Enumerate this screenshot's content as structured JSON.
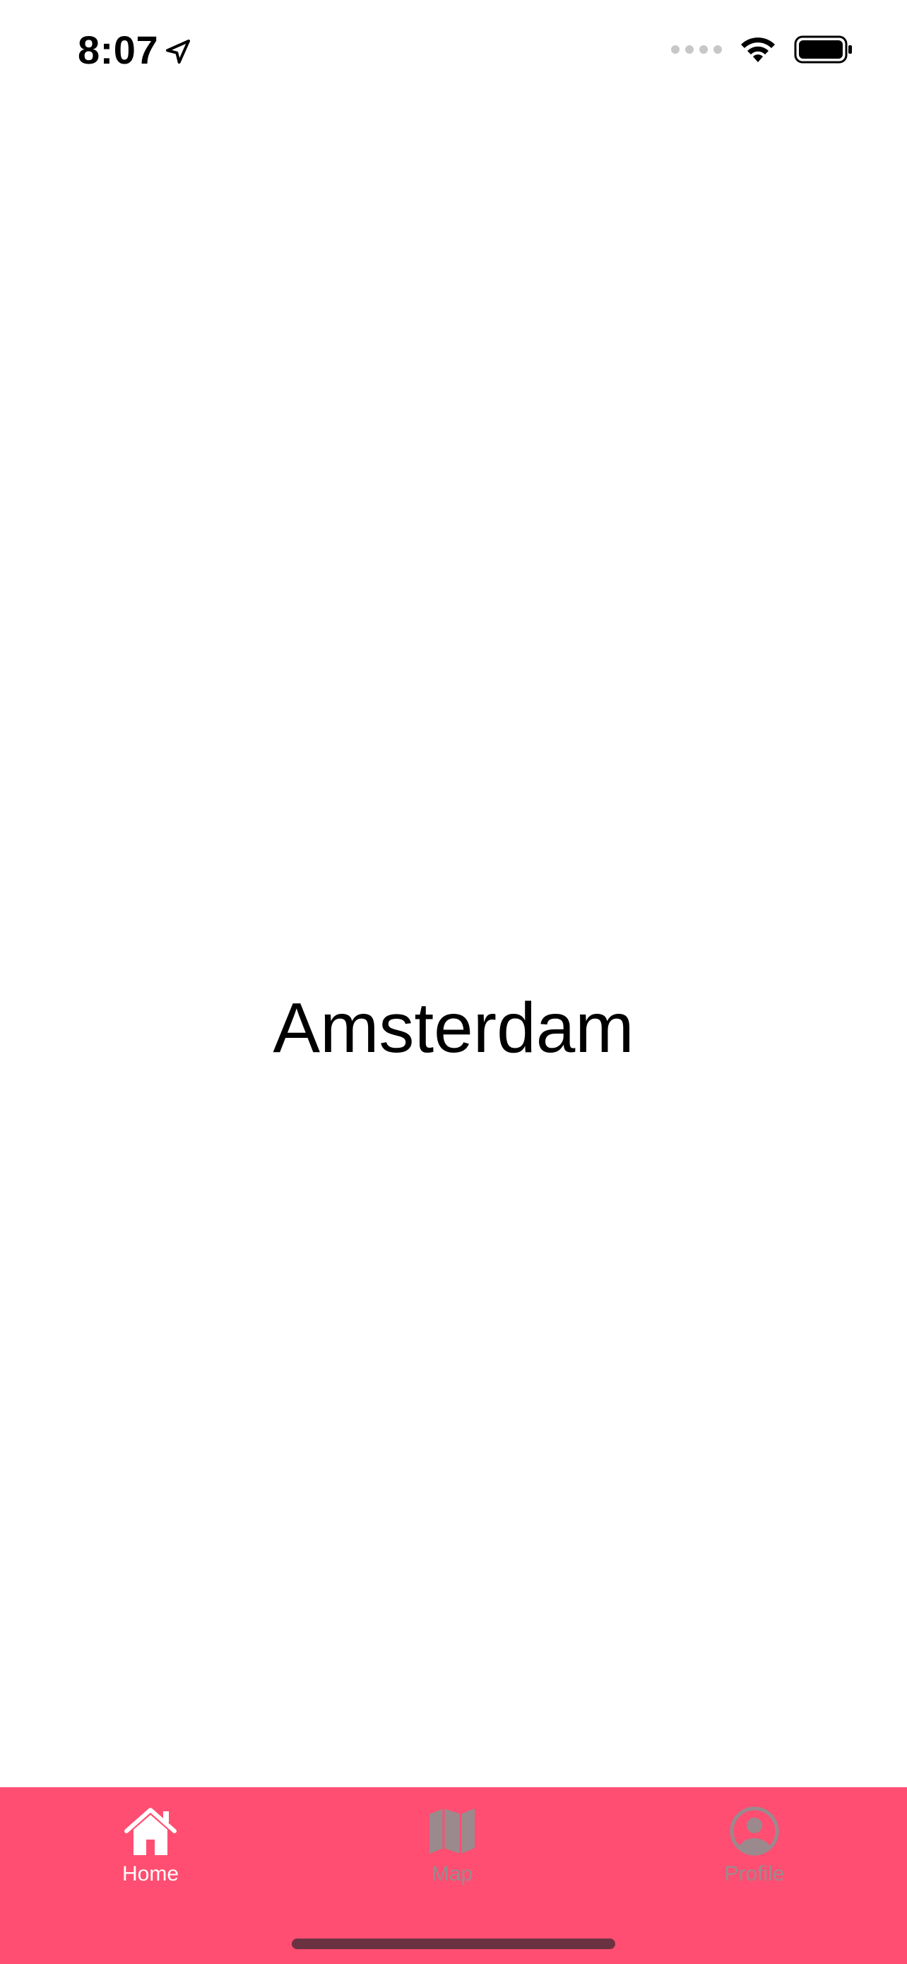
{
  "status_bar": {
    "time": "8:07",
    "icons": [
      "location-arrow-icon",
      "signal-icon",
      "wifi-icon",
      "battery-icon"
    ]
  },
  "main": {
    "title": "Amsterdam"
  },
  "tab_bar": {
    "background": "#ff4e71",
    "active_color": "#ffffff",
    "inactive_color": "#9a8a8e",
    "tabs": [
      {
        "label": "Home",
        "icon": "home-icon",
        "active": true
      },
      {
        "label": "Map",
        "icon": "map-icon",
        "active": false
      },
      {
        "label": "Profile",
        "icon": "profile-icon",
        "active": false
      }
    ]
  }
}
